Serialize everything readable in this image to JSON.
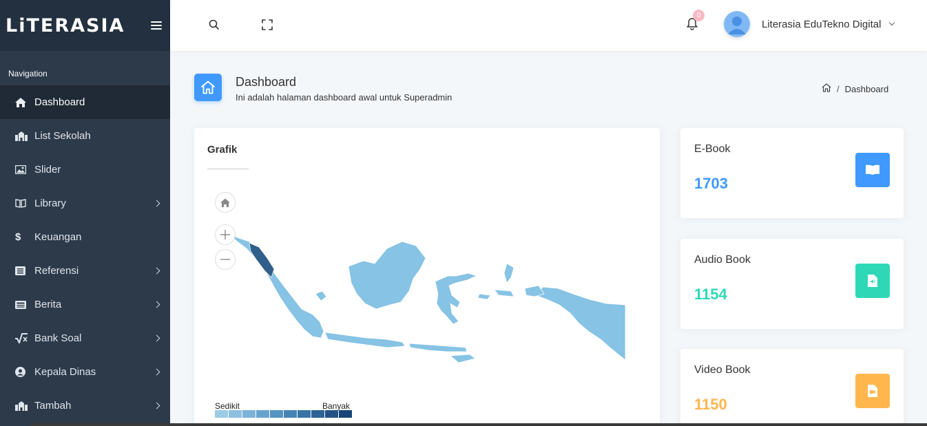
{
  "brand": {
    "logo_text": "LiTERASIA"
  },
  "sidebar": {
    "caption": "Navigation",
    "items": [
      {
        "label": "Dashboard",
        "icon": "home-icon",
        "active": true,
        "has_submenu": false
      },
      {
        "label": "List Sekolah",
        "icon": "school-icon",
        "active": false,
        "has_submenu": false
      },
      {
        "label": "Slider",
        "icon": "image-icon",
        "active": false,
        "has_submenu": false
      },
      {
        "label": "Library",
        "icon": "book-open-icon",
        "active": false,
        "has_submenu": true
      },
      {
        "label": "Keuangan",
        "icon": "dollar-icon",
        "active": false,
        "has_submenu": false
      },
      {
        "label": "Referensi",
        "icon": "list-icon",
        "active": false,
        "has_submenu": true
      },
      {
        "label": "Berita",
        "icon": "newspaper-icon",
        "active": false,
        "has_submenu": true
      },
      {
        "label": "Bank Soal",
        "icon": "square-root-icon",
        "active": false,
        "has_submenu": true
      },
      {
        "label": "Kepala Dinas",
        "icon": "user-circle-icon",
        "active": false,
        "has_submenu": true
      },
      {
        "label": "Tambah",
        "icon": "school-icon",
        "active": false,
        "has_submenu": true
      }
    ]
  },
  "header": {
    "notification_count": "0",
    "user_name": "Literasia EduTekno Digital"
  },
  "page": {
    "title": "Dashboard",
    "subtitle": "Ini adalah halaman dashboard awal untuk Superadmin",
    "breadcrumb": [
      "Dashboard"
    ]
  },
  "map_card": {
    "title": "Grafik",
    "legend_low": "Sedikit",
    "legend_high": "Banyak",
    "legend_colors": [
      "#9ccbe6",
      "#8cc0e0",
      "#7ab2d8",
      "#68a3cf",
      "#5593c2",
      "#4684b6",
      "#3873a6",
      "#2c6296",
      "#225286",
      "#184477"
    ],
    "region_color": "#86c3e4",
    "highlight_color": "#2f5f8a"
  },
  "stats": [
    {
      "label": "E-Book",
      "value": "1703",
      "color": "#4099ff",
      "icon": "book-icon"
    },
    {
      "label": "Audio Book",
      "value": "1154",
      "color": "#2ed8b6",
      "icon": "audio-file-icon"
    },
    {
      "label": "Video Book",
      "value": "1150",
      "color": "#ffb64d",
      "icon": "video-file-icon"
    }
  ]
}
